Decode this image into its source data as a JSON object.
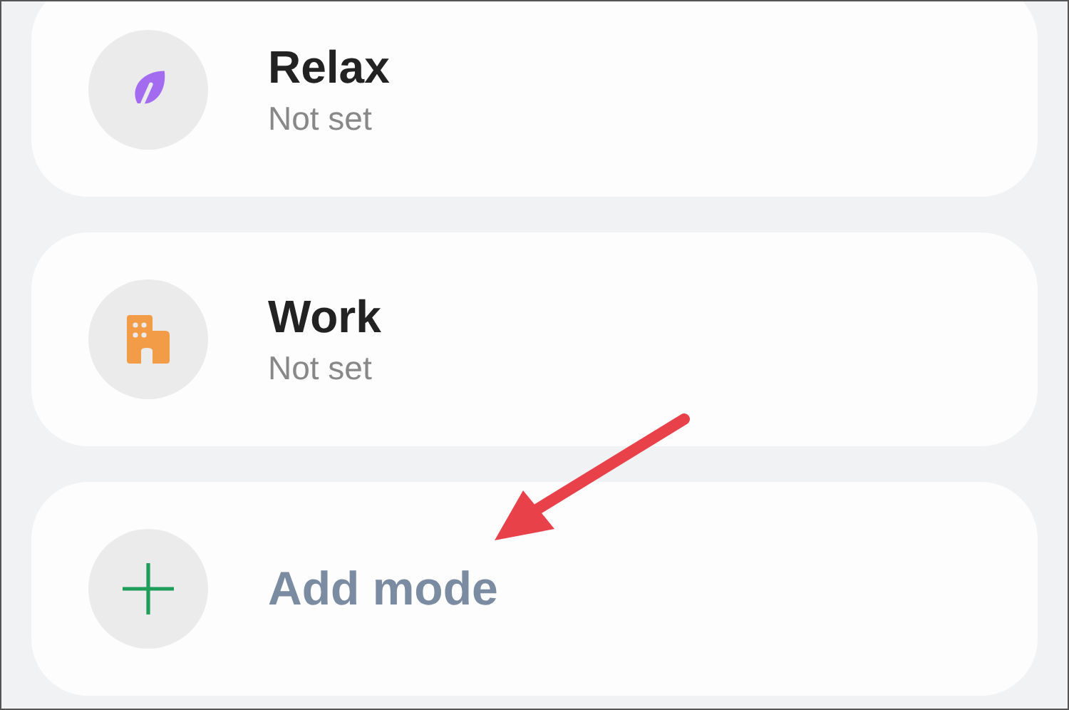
{
  "modes": [
    {
      "kind": "leaf",
      "title": "Relax",
      "subtitle": "Not set"
    },
    {
      "kind": "building",
      "title": "Work",
      "subtitle": "Not set"
    },
    {
      "kind": "add",
      "title": "Add mode"
    }
  ]
}
